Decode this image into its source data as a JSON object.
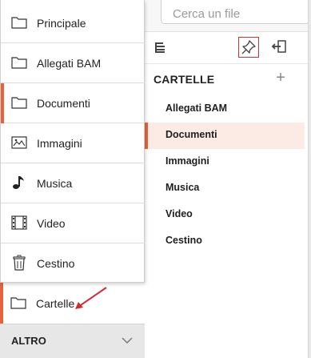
{
  "search": {
    "placeholder": "Cerca un file"
  },
  "toolbar": {
    "collapse_icon": "collapse-list-icon",
    "pin_icon": "pin-icon",
    "exit_icon": "exit-panel-icon"
  },
  "folders": {
    "title": "CARTELLE",
    "add_label": "+",
    "items": [
      {
        "label": "Allegati BAM",
        "active": false
      },
      {
        "label": "Documenti",
        "active": true
      },
      {
        "label": "Immagini",
        "active": false
      },
      {
        "label": "Musica",
        "active": false
      },
      {
        "label": "Video",
        "active": false
      },
      {
        "label": "Cestino",
        "active": false
      }
    ]
  },
  "sidebar": {
    "items": [
      {
        "label": "Principale",
        "icon": "folder-icon"
      },
      {
        "label": "Allegati BAM",
        "icon": "folder-icon"
      },
      {
        "label": "Documenti",
        "icon": "document-icon",
        "active": true
      },
      {
        "label": "Immagini",
        "icon": "image-icon"
      },
      {
        "label": "Musica",
        "icon": "music-note-icon"
      },
      {
        "label": "Video",
        "icon": "film-icon"
      },
      {
        "label": "Cestino",
        "icon": "trash-icon"
      }
    ],
    "cartelle": {
      "label": "Cartelle",
      "icon": "folder-icon"
    },
    "altro": {
      "label": "ALTRO"
    }
  },
  "colors": {
    "accent": "#e6623d",
    "active_bg": "#fcebe5",
    "annotation_arrow": "#d42a2a",
    "pin_border": "#c83535"
  }
}
